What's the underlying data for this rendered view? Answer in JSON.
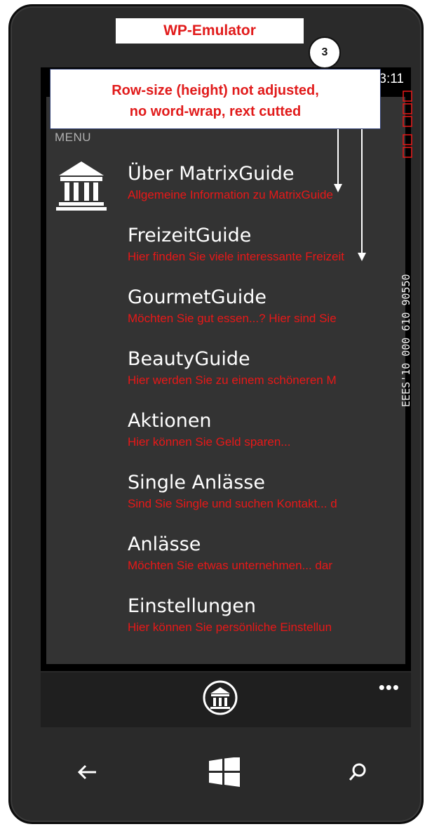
{
  "emulator_label": "WP-Emulator",
  "badge_number": "3",
  "status": {
    "time": "3:11",
    "indicator": "..."
  },
  "callout": {
    "line1": "Row-size (height) not adjusted,",
    "line2": "no word-wrap, rext cutted"
  },
  "menu_title": "MENU",
  "items": [
    {
      "title": "Über MatrixGuide",
      "subtitle": "Allgemeine Information zu MatrixGuide"
    },
    {
      "title": "FreizeitGuide",
      "subtitle": "Hier finden Sie viele interessante Freizeit"
    },
    {
      "title": "GourmetGuide",
      "subtitle": "Möchten Sie gut essen...? Hier sind Sie"
    },
    {
      "title": "BeautyGuide",
      "subtitle": "Hier werden Sie zu einem schöneren M"
    },
    {
      "title": "Aktionen",
      "subtitle": "Hier können Sie Geld sparen..."
    },
    {
      "title": "Single Anlässe",
      "subtitle": "Sind Sie Single und suchen Kontakt... d"
    },
    {
      "title": "Anlässe",
      "subtitle": "Möchten Sie etwas unternehmen... dar"
    },
    {
      "title": "Einstellungen",
      "subtitle": "Hier können Sie persönliche Einstellun"
    }
  ],
  "debug_strip": "EEES'10 000 610 90550",
  "appbar": {
    "more": "•••"
  },
  "nav": {
    "back_icon": "back-arrow-icon",
    "start_icon": "windows-logo-icon",
    "search_icon": "search-icon"
  },
  "colors": {
    "accent_red": "#e81818",
    "panel": "#333333",
    "phone_body": "#2a2a2a"
  }
}
